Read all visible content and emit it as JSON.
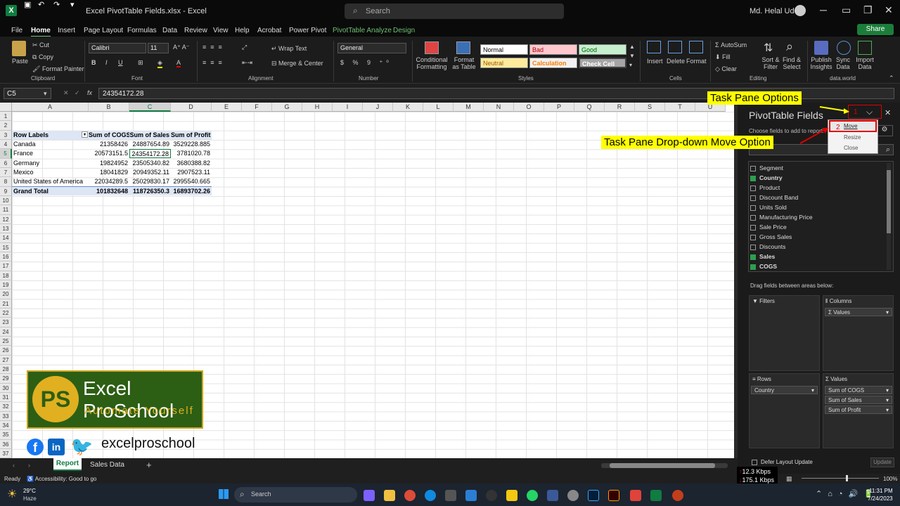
{
  "window": {
    "title": "Excel PivotTable Fields.xlsx  -  Excel",
    "search_placeholder": "Search",
    "user": "Md. Helal Uddin"
  },
  "tabs": [
    "File",
    "Home",
    "Insert",
    "Page Layout",
    "Formulas",
    "Data",
    "Review",
    "View",
    "Help",
    "Acrobat",
    "Power Pivot",
    "PivotTable Analyze",
    "Design"
  ],
  "share_label": "Share",
  "ribbon": {
    "paste": "Paste",
    "cut": "Cut",
    "copy": "Copy",
    "format_painter": "Format Painter",
    "font_name": "Calibri",
    "font_size": "11",
    "wrap_text": "Wrap Text",
    "merge_center": "Merge & Center",
    "number_format": "General",
    "conditional_formatting": "Conditional Formatting",
    "format_as_table": "Format as Table",
    "styles": {
      "normal": "Normal",
      "bad": "Bad",
      "good": "Good",
      "neutral": "Neutral",
      "calculation": "Calculation",
      "check_cell": "Check Cell"
    },
    "insert": "Insert",
    "delete": "Delete",
    "format": "Format",
    "autosum": "AutoSum",
    "fill": "Fill",
    "clear": "Clear",
    "sort_filter": "Sort & Filter",
    "find_select": "Find & Select",
    "publish_insights": "Publish Insights",
    "sync_data": "Sync Data",
    "import_data": "Import Data",
    "groups": {
      "clipboard": "Clipboard",
      "font": "Font",
      "alignment": "Alignment",
      "number": "Number",
      "styles": "Styles",
      "cells": "Cells",
      "editing": "Editing",
      "dataworld": "data.world"
    }
  },
  "formula_bar": {
    "name_box": "C5",
    "fx": "fx",
    "value": "24354172.28"
  },
  "columns": [
    "A",
    "B",
    "C",
    "D",
    "E",
    "F",
    "G",
    "H",
    "I",
    "J",
    "K",
    "L",
    "M",
    "N",
    "O",
    "P",
    "Q",
    "R",
    "S",
    "T",
    "U"
  ],
  "rows": [
    "1",
    "2",
    "3",
    "4",
    "5",
    "6",
    "7",
    "8",
    "9",
    "10",
    "11",
    "12",
    "13",
    "14",
    "15",
    "16",
    "17",
    "18",
    "19",
    "20",
    "21",
    "22",
    "23",
    "24",
    "25",
    "26",
    "27",
    "28",
    "29",
    "30",
    "31",
    "32",
    "33",
    "34",
    "35",
    "36",
    "37"
  ],
  "pivot": {
    "headers": [
      "Row Labels",
      "Sum of COGS",
      "Sum of  Sales",
      "Sum of Profit"
    ],
    "data": [
      [
        "Canada",
        "21358426",
        "24887654.89",
        "3529228.885"
      ],
      [
        "France",
        "20573151.5",
        "24354172.28",
        "3781020.78"
      ],
      [
        "Germany",
        "19824952",
        "23505340.82",
        "3680388.82"
      ],
      [
        "Mexico",
        "18041829",
        "20949352.11",
        "2907523.11"
      ],
      [
        "United States of America",
        "22034289.5",
        "25029830.17",
        "2995540.665"
      ]
    ],
    "total": [
      "Grand Total",
      "101832648",
      "118726350.3",
      "16893702.26"
    ]
  },
  "logo": {
    "title": "Excel ProSchool",
    "tagline": "Automate Yourself",
    "handle": "excelproschool"
  },
  "sheet_tabs": [
    "Report",
    "Sales Data"
  ],
  "status": {
    "ready": "Ready",
    "accessibility": "Accessibility: Good to go",
    "zoom": "100%"
  },
  "pane": {
    "title": "PivotTable Fields",
    "choose": "Choose fields to add to report:",
    "menu": [
      "Move",
      "Resize",
      "Close"
    ],
    "fields": [
      {
        "name": "Segment",
        "checked": false
      },
      {
        "name": "Country",
        "checked": true
      },
      {
        "name": "Product",
        "checked": false
      },
      {
        "name": "Discount Band",
        "checked": false
      },
      {
        "name": "Units Sold",
        "checked": false
      },
      {
        "name": "Manufacturing Price",
        "checked": false
      },
      {
        "name": "Sale Price",
        "checked": false
      },
      {
        "name": "Gross Sales",
        "checked": false
      },
      {
        "name": "Discounts",
        "checked": false
      },
      {
        "name": "Sales",
        "checked": true
      },
      {
        "name": "COGS",
        "checked": true
      }
    ],
    "drag_hint": "Drag fields between areas below:",
    "filters": "Filters",
    "columns": "Columns",
    "rows": "Rows",
    "values": "Values",
    "columns_chip": "Σ Values",
    "rows_chip": "Country",
    "values_chips": [
      "Sum of COGS",
      "Sum of  Sales",
      "Sum of Profit"
    ],
    "defer": "Defer Layout Update",
    "update": "Update"
  },
  "annotations": {
    "task_pane_options": "Task Pane Options",
    "move_option": "Task Pane Drop-down Move Option",
    "n1": "1",
    "n2": "2"
  },
  "network": {
    "up": "12.3 Kbps",
    "down": "175.1 Kbps"
  },
  "taskbar": {
    "temp": "29°C",
    "weather": "Haze",
    "search": "Search",
    "time": "11:31 PM",
    "date": "7/24/2023"
  },
  "colors": {
    "excel_green": "#107c41",
    "accent": "#6fbf73",
    "callout": "#ffff00",
    "highlight_red": "#e00000"
  }
}
